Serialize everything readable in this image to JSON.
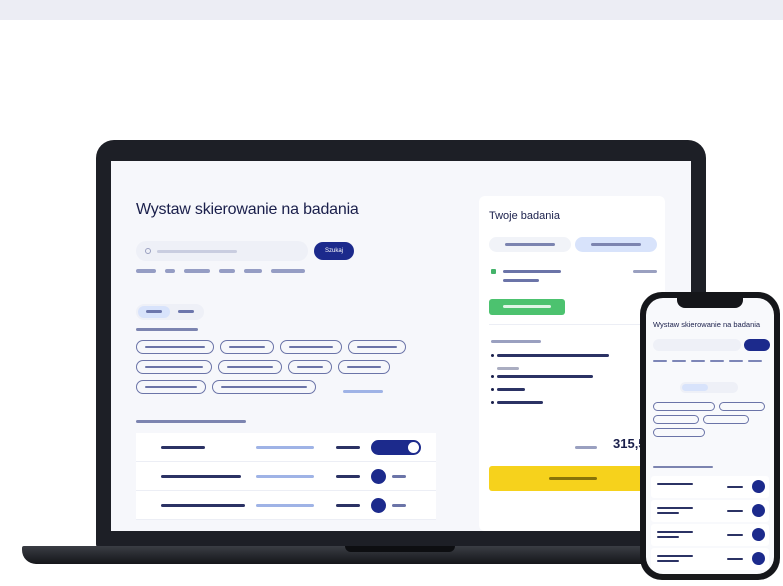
{
  "laptop": {
    "main": {
      "title": "Wystaw skierowanie na badania",
      "search_button": "Szukaj"
    },
    "summary": {
      "title": "Twoje badania",
      "total": "315,5"
    }
  },
  "phone": {
    "title": "Wystaw skierowanie na badania"
  },
  "colors": {
    "primary": "#1c2a8c",
    "accent_green": "#4cc26f",
    "cta_yellow": "#f6d21c",
    "tab_active": "#d8e3fb"
  }
}
